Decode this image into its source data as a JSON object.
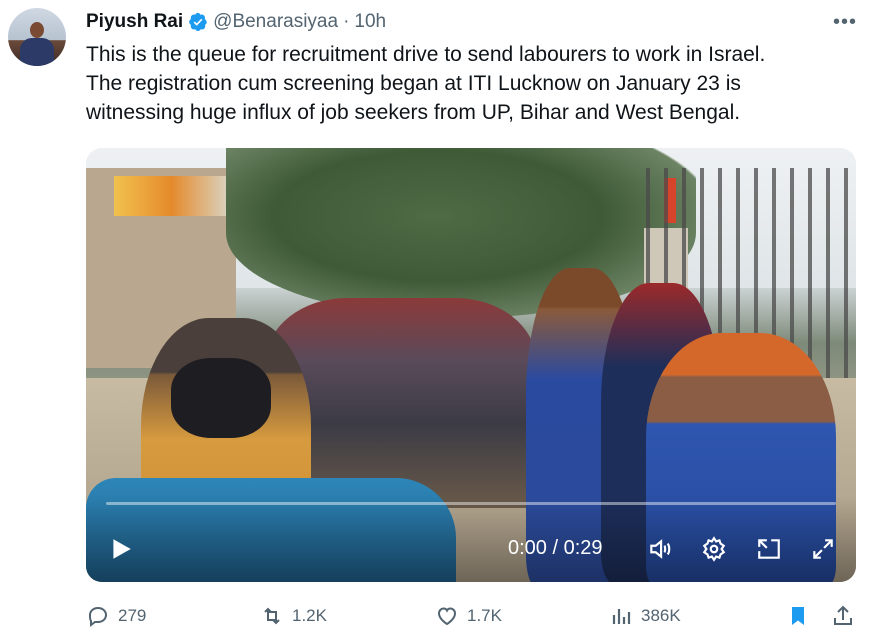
{
  "tweet": {
    "author_name": "Piyush Rai",
    "handle": "@Benarasiyaa",
    "separator": "·",
    "time": "10h",
    "more_label": "•••",
    "text_lines": [
      "This is the queue for recruitment drive to send labourers to work in Israel.",
      "The registration cum screening began at ITI Lucknow on January 23 is",
      "witnessing huge influx of job seekers from UP, Bihar and West Bengal."
    ]
  },
  "video": {
    "timecode": "0:00 / 0:29"
  },
  "actions": {
    "replies": "279",
    "retweets": "1.2K",
    "likes": "1.7K",
    "views": "386K"
  },
  "colors": {
    "accent": "#1d9bf0",
    "muted": "#536471",
    "text": "#0f1419",
    "bookmark_active": "#1d9bf0"
  },
  "icons": {
    "verified": "verified-badge-icon",
    "reply": "reply-icon",
    "retweet": "retweet-icon",
    "like": "heart-icon",
    "views": "views-icon",
    "bookmark": "bookmark-icon",
    "share": "share-icon"
  }
}
